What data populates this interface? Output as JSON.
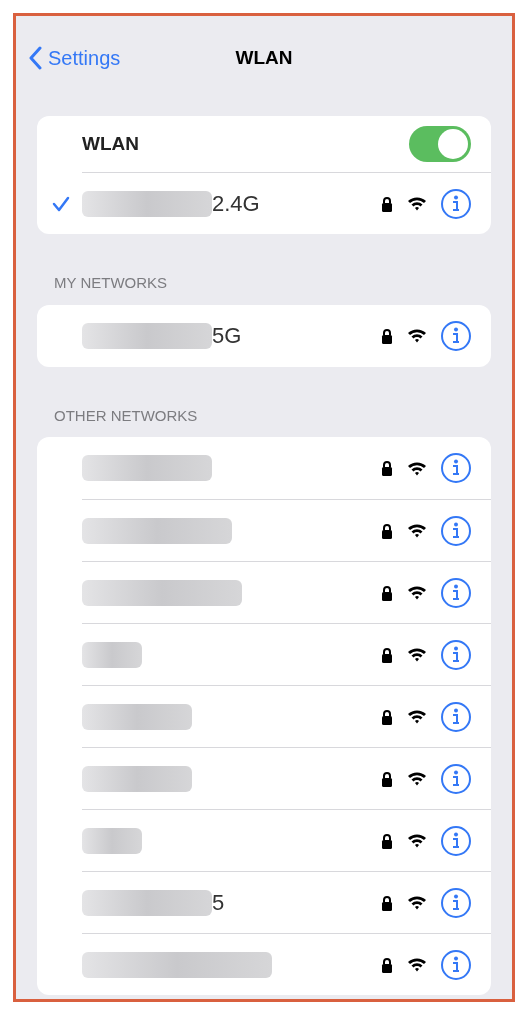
{
  "nav": {
    "back": "Settings",
    "title": "WLAN"
  },
  "wlan": {
    "label": "WLAN",
    "on": true
  },
  "current": [
    {
      "name": "2.4G",
      "redacted": true,
      "connected": true,
      "locked": true
    }
  ],
  "my_networks": {
    "header": "MY NETWORKS",
    "items": [
      {
        "name": "5G",
        "redacted": true,
        "connected": false,
        "locked": true
      }
    ]
  },
  "other_networks": {
    "header": "OTHER NETWORKS",
    "items": [
      {
        "redacted": true,
        "locked": true
      },
      {
        "redacted": true,
        "locked": true
      },
      {
        "redacted": true,
        "locked": true
      },
      {
        "redacted": true,
        "locked": true
      },
      {
        "redacted": true,
        "locked": true
      },
      {
        "redacted": true,
        "locked": true
      },
      {
        "redacted": true,
        "locked": true
      },
      {
        "name": "5",
        "redacted": true,
        "locked": true
      },
      {
        "redacted": true,
        "locked": true
      }
    ]
  }
}
